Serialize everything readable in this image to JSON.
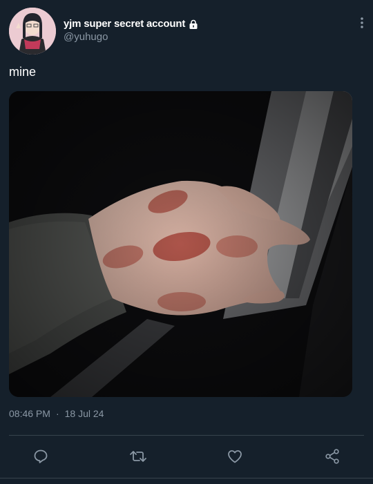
{
  "tweet": {
    "display_name": "yjm super secret account",
    "handle": "@yuhugo",
    "text": "mine",
    "time": "08:46 PM",
    "separator": "·",
    "date": "18 Jul 24"
  },
  "icons": {
    "lock": "lock-icon",
    "more": "more-vertical-icon",
    "reply": "reply-icon",
    "retweet": "retweet-icon",
    "like": "heart-icon",
    "share": "share-icon"
  },
  "colors": {
    "background": "#15202b",
    "secondary_text": "#8b98a5",
    "divider": "#38444d"
  }
}
